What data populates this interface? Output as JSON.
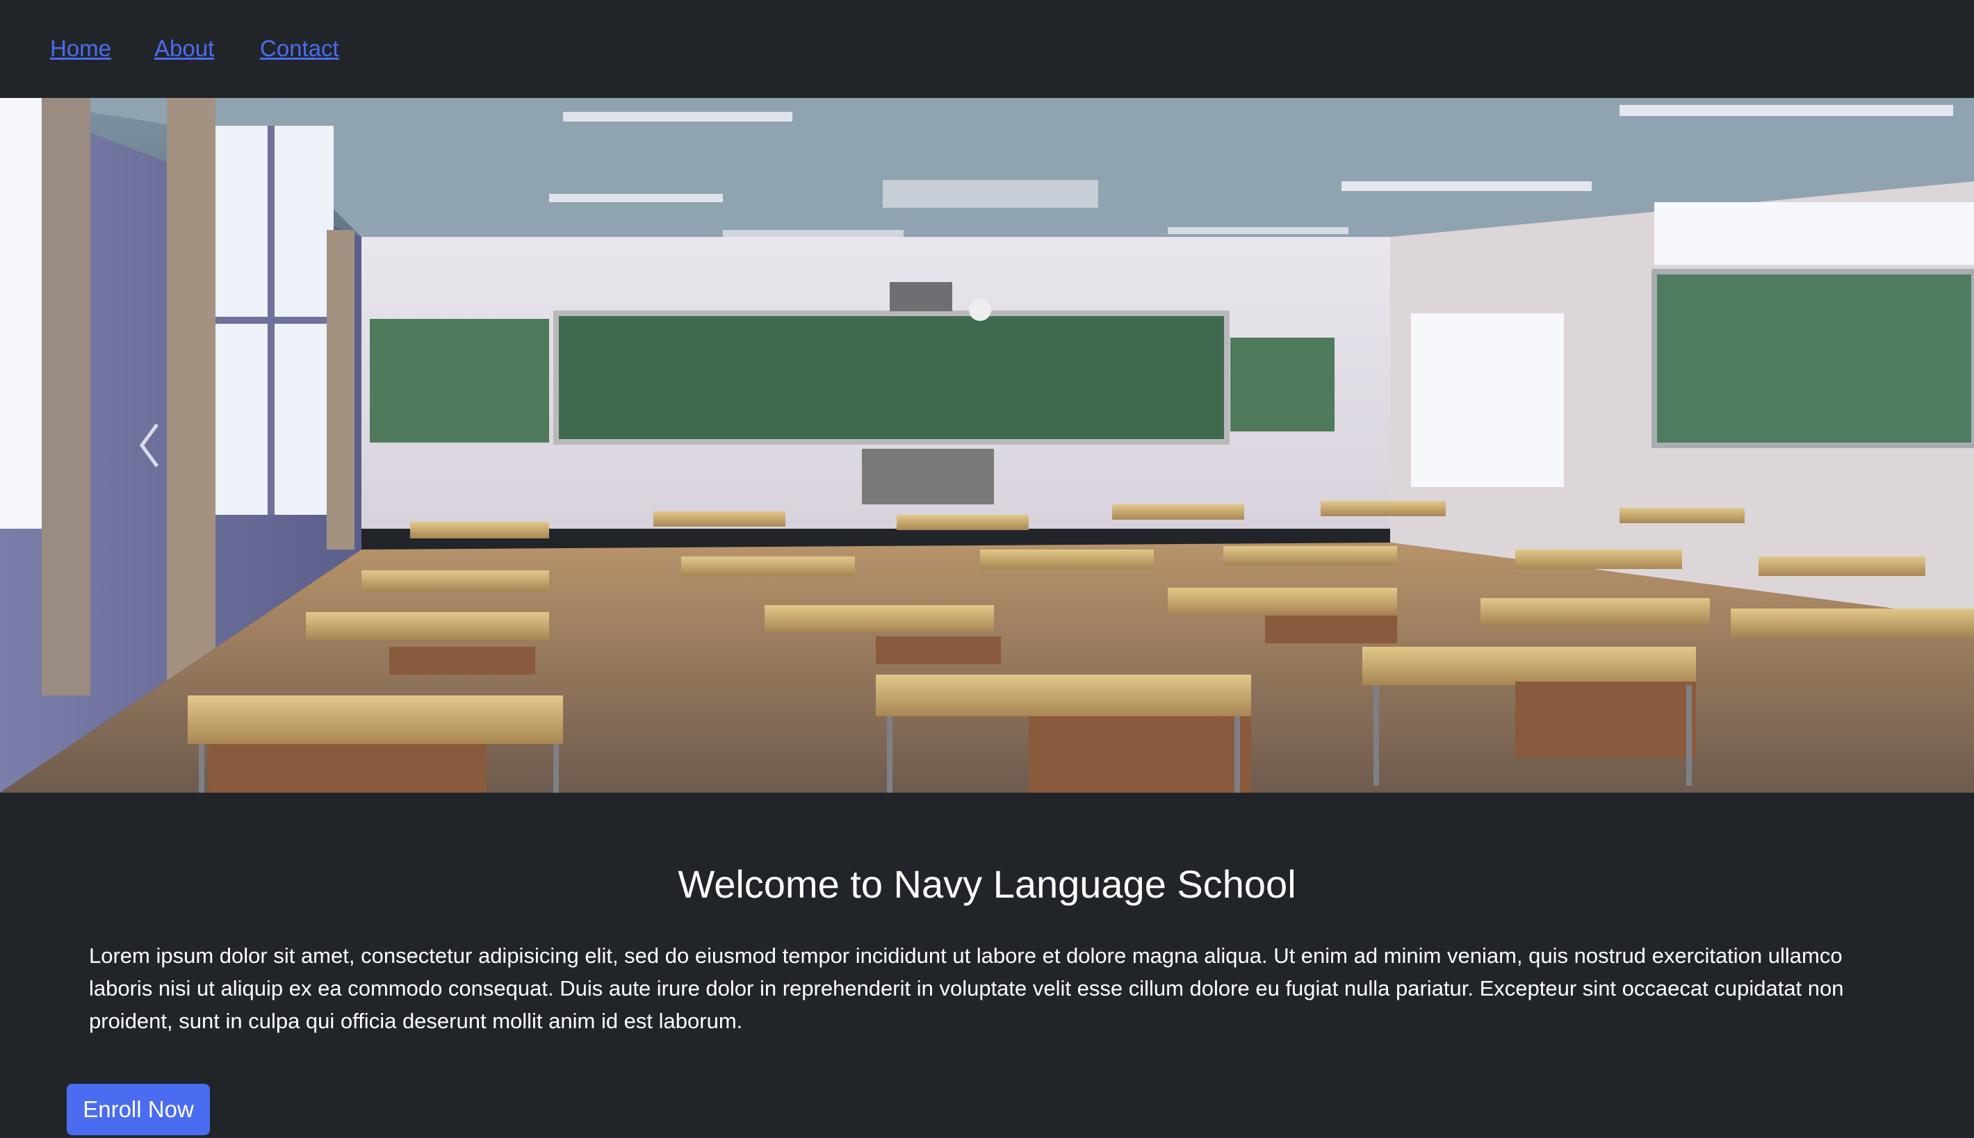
{
  "nav": {
    "links": [
      {
        "label": "Home"
      },
      {
        "label": "About"
      },
      {
        "label": "Contact"
      }
    ],
    "link_color": "#4a6cf0"
  },
  "carousel": {
    "image_description_icon": "classroom-photo",
    "prev_icon": "chevron-left-icon",
    "next_icon": "chevron-right-icon",
    "slide_count": 3,
    "active_slide": 3
  },
  "main": {
    "title": "Welcome to Navy Language School",
    "body": "Lorem ipsum dolor sit amet, consectetur adipisicing elit, sed do eiusmod tempor incididunt ut labore et dolore magna aliqua. Ut enim ad minim veniam, quis nostrud exercitation ullamco laboris nisi ut aliquip ex ea commodo consequat. Duis aute irure dolor in reprehenderit in voluptate velit esse cillum dolore eu fugiat nulla pariatur. Excepteur sint occaecat cupidatat non proident, sunt in culpa qui officia deserunt mollit anim id est laborum.",
    "cta_label": "Enroll Now"
  },
  "colors": {
    "background": "#212529",
    "accent": "#4a6cf0",
    "text": "#ffffff"
  }
}
